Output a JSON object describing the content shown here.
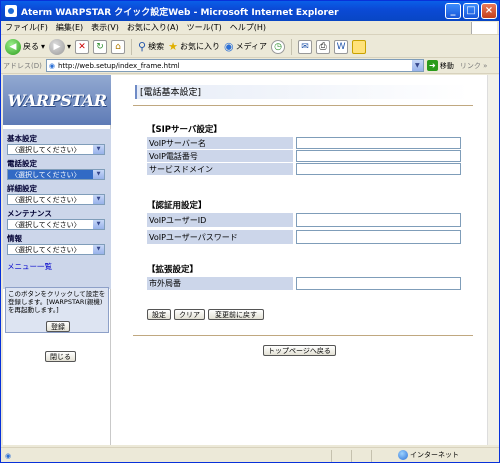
{
  "window": {
    "title": "Aterm WARPSTAR クイック設定Web - Microsoft Internet Explorer"
  },
  "menu": [
    "ファイル(F)",
    "編集(E)",
    "表示(V)",
    "お気に入り(A)",
    "ツール(T)",
    "ヘルプ(H)"
  ],
  "toolbar": {
    "back": "戻る",
    "search": "検索",
    "favorites": "お気に入り",
    "media": "メディア"
  },
  "address": {
    "label": "アドレス(D)",
    "url": "http://web.setup/index_frame.html",
    "go": "移動",
    "links": "リンク"
  },
  "sidebar": {
    "logo": "WARPSTAR",
    "groups": [
      {
        "label": "基本設定",
        "value": "〈選択してください〉"
      },
      {
        "label": "電話設定",
        "value": "〈選択してください〉"
      },
      {
        "label": "詳細設定",
        "value": "〈選択してください〉"
      },
      {
        "label": "メンテナンス",
        "value": "〈選択してください〉"
      },
      {
        "label": "情報",
        "value": "〈選択してください〉"
      }
    ],
    "menu_list": "メニュー一覧",
    "info_text": "このボタンをクリックして設定を登録します。[WARPSTAR(親機)を再起動します。]",
    "register": "登録",
    "close": "閉じる"
  },
  "main": {
    "title": "[電話基本設定]",
    "sections": [
      {
        "heading": "【SIPサーバ設定】",
        "fields": [
          "VoIPサーバー名",
          "VoIP電話番号",
          "サービスドメイン"
        ]
      },
      {
        "heading": "【認証用設定】",
        "fields": [
          "VoIPユーザーID",
          "VoIPユーザーパスワード"
        ]
      },
      {
        "heading": "【拡張設定】",
        "fields": [
          "市外局番"
        ]
      }
    ],
    "buttons": {
      "set": "設定",
      "clear": "クリア",
      "revert": "変更前に戻す"
    },
    "top_page": "トップページへ戻る"
  },
  "status": {
    "zone": "インターネット"
  }
}
